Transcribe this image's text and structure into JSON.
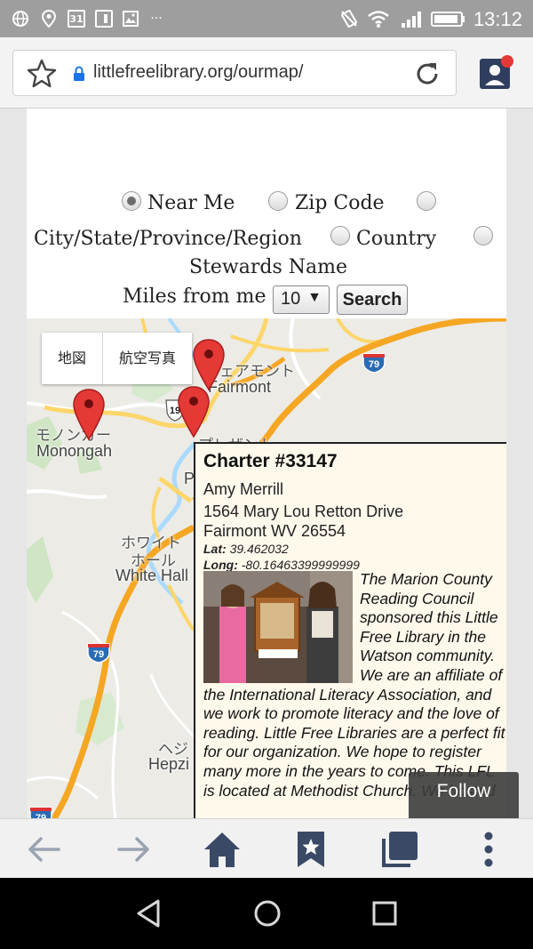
{
  "status_bar": {
    "time": "13:12",
    "calendar_day": "31",
    "more": "···",
    "icons": [
      "globe-icon",
      "location-icon",
      "calendar-icon",
      "sim-icon",
      "image-icon",
      "more-icon",
      "vibrate-icon",
      "wifi-icon",
      "signal-icon",
      "battery-icon"
    ]
  },
  "browser": {
    "url": "littlefreelibrary.org/ourmap/",
    "icons": [
      "star-icon",
      "lock-icon",
      "reload-icon",
      "profile-icon"
    ]
  },
  "search_form": {
    "options": [
      "Near Me",
      "Zip Code",
      "City/State/Province/Region",
      "Country",
      "Stewards Name"
    ],
    "selected": "Near Me",
    "miles_label": "Miles from me",
    "miles_value": "10",
    "search_button": "Search"
  },
  "map": {
    "type_buttons": [
      "地図",
      "航空写真"
    ],
    "labels": {
      "fairmont_jp": "フェアモント",
      "fairmont": "Fairmont",
      "monongah_jp": "モノンガー",
      "monongah": "Monongah",
      "white_hall_jp1": "ホワイト",
      "white_hall_jp2": "ホール",
      "white_hall": "White Hall",
      "hepzibah_jp": "ヘジ",
      "hepzibah": "Hepzi",
      "pleasant_jp": "プレザント",
      "p_label": "P"
    },
    "shields": {
      "i79_top": "79",
      "i79_mid": "79",
      "i79_bottom": "79",
      "us19": "19"
    },
    "info_window": {
      "title": "Charter #33147",
      "name": "Amy Merrill",
      "address1": "1564 Mary Lou Retton Drive",
      "address2": "Fairmont WV 26554",
      "lat_label": "Lat:",
      "lat": "39.462032",
      "long_label": "Long:",
      "long": "-80.16463399999999",
      "description": "The Marion County Reading Council sponsored this Little Free Library in the Watson community. We are an affiliate of the International Literacy Association, and we work to promote literacy and the love of reading. Little Free Libraries are a perfect fit for our organization. We hope to register many more in the years to come. This LFL is located at Methodist Church. We hosted"
    }
  },
  "follow_button": "Follow",
  "toolbar": {
    "icons": [
      "back-arrow-icon",
      "forward-arrow-icon",
      "home-icon",
      "bookmarks-icon",
      "tabs-icon",
      "menu-icon"
    ]
  },
  "navbar": {
    "icons": [
      "nav-back-icon",
      "nav-home-icon",
      "nav-recents-icon"
    ]
  },
  "colors": {
    "status_bar": "#9e9e9e",
    "pin_red": "#e53935",
    "highway_orange": "#f5a623",
    "interstate_blue": "#2a6bb5",
    "toolbar_icon": "#3a4a66",
    "info_bg": "#fff9ec"
  }
}
